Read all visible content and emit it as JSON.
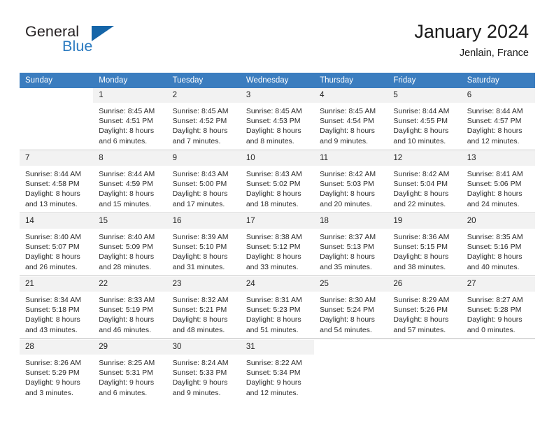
{
  "brand": {
    "name_part1": "General",
    "name_part2": "Blue",
    "triangle_icon": "triangle-icon"
  },
  "header": {
    "title": "January 2024",
    "subtitle": "Jenlain, France"
  },
  "calendar": {
    "weekday_headers": [
      "Sunday",
      "Monday",
      "Tuesday",
      "Wednesday",
      "Thursday",
      "Friday",
      "Saturday"
    ],
    "accent_color": "#3b7dbf",
    "daynum_band_color": "#f2f2f2",
    "weeks": [
      [
        {
          "day": "",
          "blank": true,
          "sunrise": "",
          "sunset": "",
          "daylight1": "",
          "daylight2": ""
        },
        {
          "day": "1",
          "sunrise": "Sunrise: 8:45 AM",
          "sunset": "Sunset: 4:51 PM",
          "daylight1": "Daylight: 8 hours",
          "daylight2": "and 6 minutes."
        },
        {
          "day": "2",
          "sunrise": "Sunrise: 8:45 AM",
          "sunset": "Sunset: 4:52 PM",
          "daylight1": "Daylight: 8 hours",
          "daylight2": "and 7 minutes."
        },
        {
          "day": "3",
          "sunrise": "Sunrise: 8:45 AM",
          "sunset": "Sunset: 4:53 PM",
          "daylight1": "Daylight: 8 hours",
          "daylight2": "and 8 minutes."
        },
        {
          "day": "4",
          "sunrise": "Sunrise: 8:45 AM",
          "sunset": "Sunset: 4:54 PM",
          "daylight1": "Daylight: 8 hours",
          "daylight2": "and 9 minutes."
        },
        {
          "day": "5",
          "sunrise": "Sunrise: 8:44 AM",
          "sunset": "Sunset: 4:55 PM",
          "daylight1": "Daylight: 8 hours",
          "daylight2": "and 10 minutes."
        },
        {
          "day": "6",
          "sunrise": "Sunrise: 8:44 AM",
          "sunset": "Sunset: 4:57 PM",
          "daylight1": "Daylight: 8 hours",
          "daylight2": "and 12 minutes."
        }
      ],
      [
        {
          "day": "7",
          "sunrise": "Sunrise: 8:44 AM",
          "sunset": "Sunset: 4:58 PM",
          "daylight1": "Daylight: 8 hours",
          "daylight2": "and 13 minutes."
        },
        {
          "day": "8",
          "sunrise": "Sunrise: 8:44 AM",
          "sunset": "Sunset: 4:59 PM",
          "daylight1": "Daylight: 8 hours",
          "daylight2": "and 15 minutes."
        },
        {
          "day": "9",
          "sunrise": "Sunrise: 8:43 AM",
          "sunset": "Sunset: 5:00 PM",
          "daylight1": "Daylight: 8 hours",
          "daylight2": "and 17 minutes."
        },
        {
          "day": "10",
          "sunrise": "Sunrise: 8:43 AM",
          "sunset": "Sunset: 5:02 PM",
          "daylight1": "Daylight: 8 hours",
          "daylight2": "and 18 minutes."
        },
        {
          "day": "11",
          "sunrise": "Sunrise: 8:42 AM",
          "sunset": "Sunset: 5:03 PM",
          "daylight1": "Daylight: 8 hours",
          "daylight2": "and 20 minutes."
        },
        {
          "day": "12",
          "sunrise": "Sunrise: 8:42 AM",
          "sunset": "Sunset: 5:04 PM",
          "daylight1": "Daylight: 8 hours",
          "daylight2": "and 22 minutes."
        },
        {
          "day": "13",
          "sunrise": "Sunrise: 8:41 AM",
          "sunset": "Sunset: 5:06 PM",
          "daylight1": "Daylight: 8 hours",
          "daylight2": "and 24 minutes."
        }
      ],
      [
        {
          "day": "14",
          "sunrise": "Sunrise: 8:40 AM",
          "sunset": "Sunset: 5:07 PM",
          "daylight1": "Daylight: 8 hours",
          "daylight2": "and 26 minutes."
        },
        {
          "day": "15",
          "sunrise": "Sunrise: 8:40 AM",
          "sunset": "Sunset: 5:09 PM",
          "daylight1": "Daylight: 8 hours",
          "daylight2": "and 28 minutes."
        },
        {
          "day": "16",
          "sunrise": "Sunrise: 8:39 AM",
          "sunset": "Sunset: 5:10 PM",
          "daylight1": "Daylight: 8 hours",
          "daylight2": "and 31 minutes."
        },
        {
          "day": "17",
          "sunrise": "Sunrise: 8:38 AM",
          "sunset": "Sunset: 5:12 PM",
          "daylight1": "Daylight: 8 hours",
          "daylight2": "and 33 minutes."
        },
        {
          "day": "18",
          "sunrise": "Sunrise: 8:37 AM",
          "sunset": "Sunset: 5:13 PM",
          "daylight1": "Daylight: 8 hours",
          "daylight2": "and 35 minutes."
        },
        {
          "day": "19",
          "sunrise": "Sunrise: 8:36 AM",
          "sunset": "Sunset: 5:15 PM",
          "daylight1": "Daylight: 8 hours",
          "daylight2": "and 38 minutes."
        },
        {
          "day": "20",
          "sunrise": "Sunrise: 8:35 AM",
          "sunset": "Sunset: 5:16 PM",
          "daylight1": "Daylight: 8 hours",
          "daylight2": "and 40 minutes."
        }
      ],
      [
        {
          "day": "21",
          "sunrise": "Sunrise: 8:34 AM",
          "sunset": "Sunset: 5:18 PM",
          "daylight1": "Daylight: 8 hours",
          "daylight2": "and 43 minutes."
        },
        {
          "day": "22",
          "sunrise": "Sunrise: 8:33 AM",
          "sunset": "Sunset: 5:19 PM",
          "daylight1": "Daylight: 8 hours",
          "daylight2": "and 46 minutes."
        },
        {
          "day": "23",
          "sunrise": "Sunrise: 8:32 AM",
          "sunset": "Sunset: 5:21 PM",
          "daylight1": "Daylight: 8 hours",
          "daylight2": "and 48 minutes."
        },
        {
          "day": "24",
          "sunrise": "Sunrise: 8:31 AM",
          "sunset": "Sunset: 5:23 PM",
          "daylight1": "Daylight: 8 hours",
          "daylight2": "and 51 minutes."
        },
        {
          "day": "25",
          "sunrise": "Sunrise: 8:30 AM",
          "sunset": "Sunset: 5:24 PM",
          "daylight1": "Daylight: 8 hours",
          "daylight2": "and 54 minutes."
        },
        {
          "day": "26",
          "sunrise": "Sunrise: 8:29 AM",
          "sunset": "Sunset: 5:26 PM",
          "daylight1": "Daylight: 8 hours",
          "daylight2": "and 57 minutes."
        },
        {
          "day": "27",
          "sunrise": "Sunrise: 8:27 AM",
          "sunset": "Sunset: 5:28 PM",
          "daylight1": "Daylight: 9 hours",
          "daylight2": "and 0 minutes."
        }
      ],
      [
        {
          "day": "28",
          "sunrise": "Sunrise: 8:26 AM",
          "sunset": "Sunset: 5:29 PM",
          "daylight1": "Daylight: 9 hours",
          "daylight2": "and 3 minutes."
        },
        {
          "day": "29",
          "sunrise": "Sunrise: 8:25 AM",
          "sunset": "Sunset: 5:31 PM",
          "daylight1": "Daylight: 9 hours",
          "daylight2": "and 6 minutes."
        },
        {
          "day": "30",
          "sunrise": "Sunrise: 8:24 AM",
          "sunset": "Sunset: 5:33 PM",
          "daylight1": "Daylight: 9 hours",
          "daylight2": "and 9 minutes."
        },
        {
          "day": "31",
          "sunrise": "Sunrise: 8:22 AM",
          "sunset": "Sunset: 5:34 PM",
          "daylight1": "Daylight: 9 hours",
          "daylight2": "and 12 minutes."
        },
        {
          "day": "",
          "blank": true,
          "sunrise": "",
          "sunset": "",
          "daylight1": "",
          "daylight2": ""
        },
        {
          "day": "",
          "blank": true,
          "sunrise": "",
          "sunset": "",
          "daylight1": "",
          "daylight2": ""
        },
        {
          "day": "",
          "blank": true,
          "sunrise": "",
          "sunset": "",
          "daylight1": "",
          "daylight2": ""
        }
      ]
    ]
  }
}
